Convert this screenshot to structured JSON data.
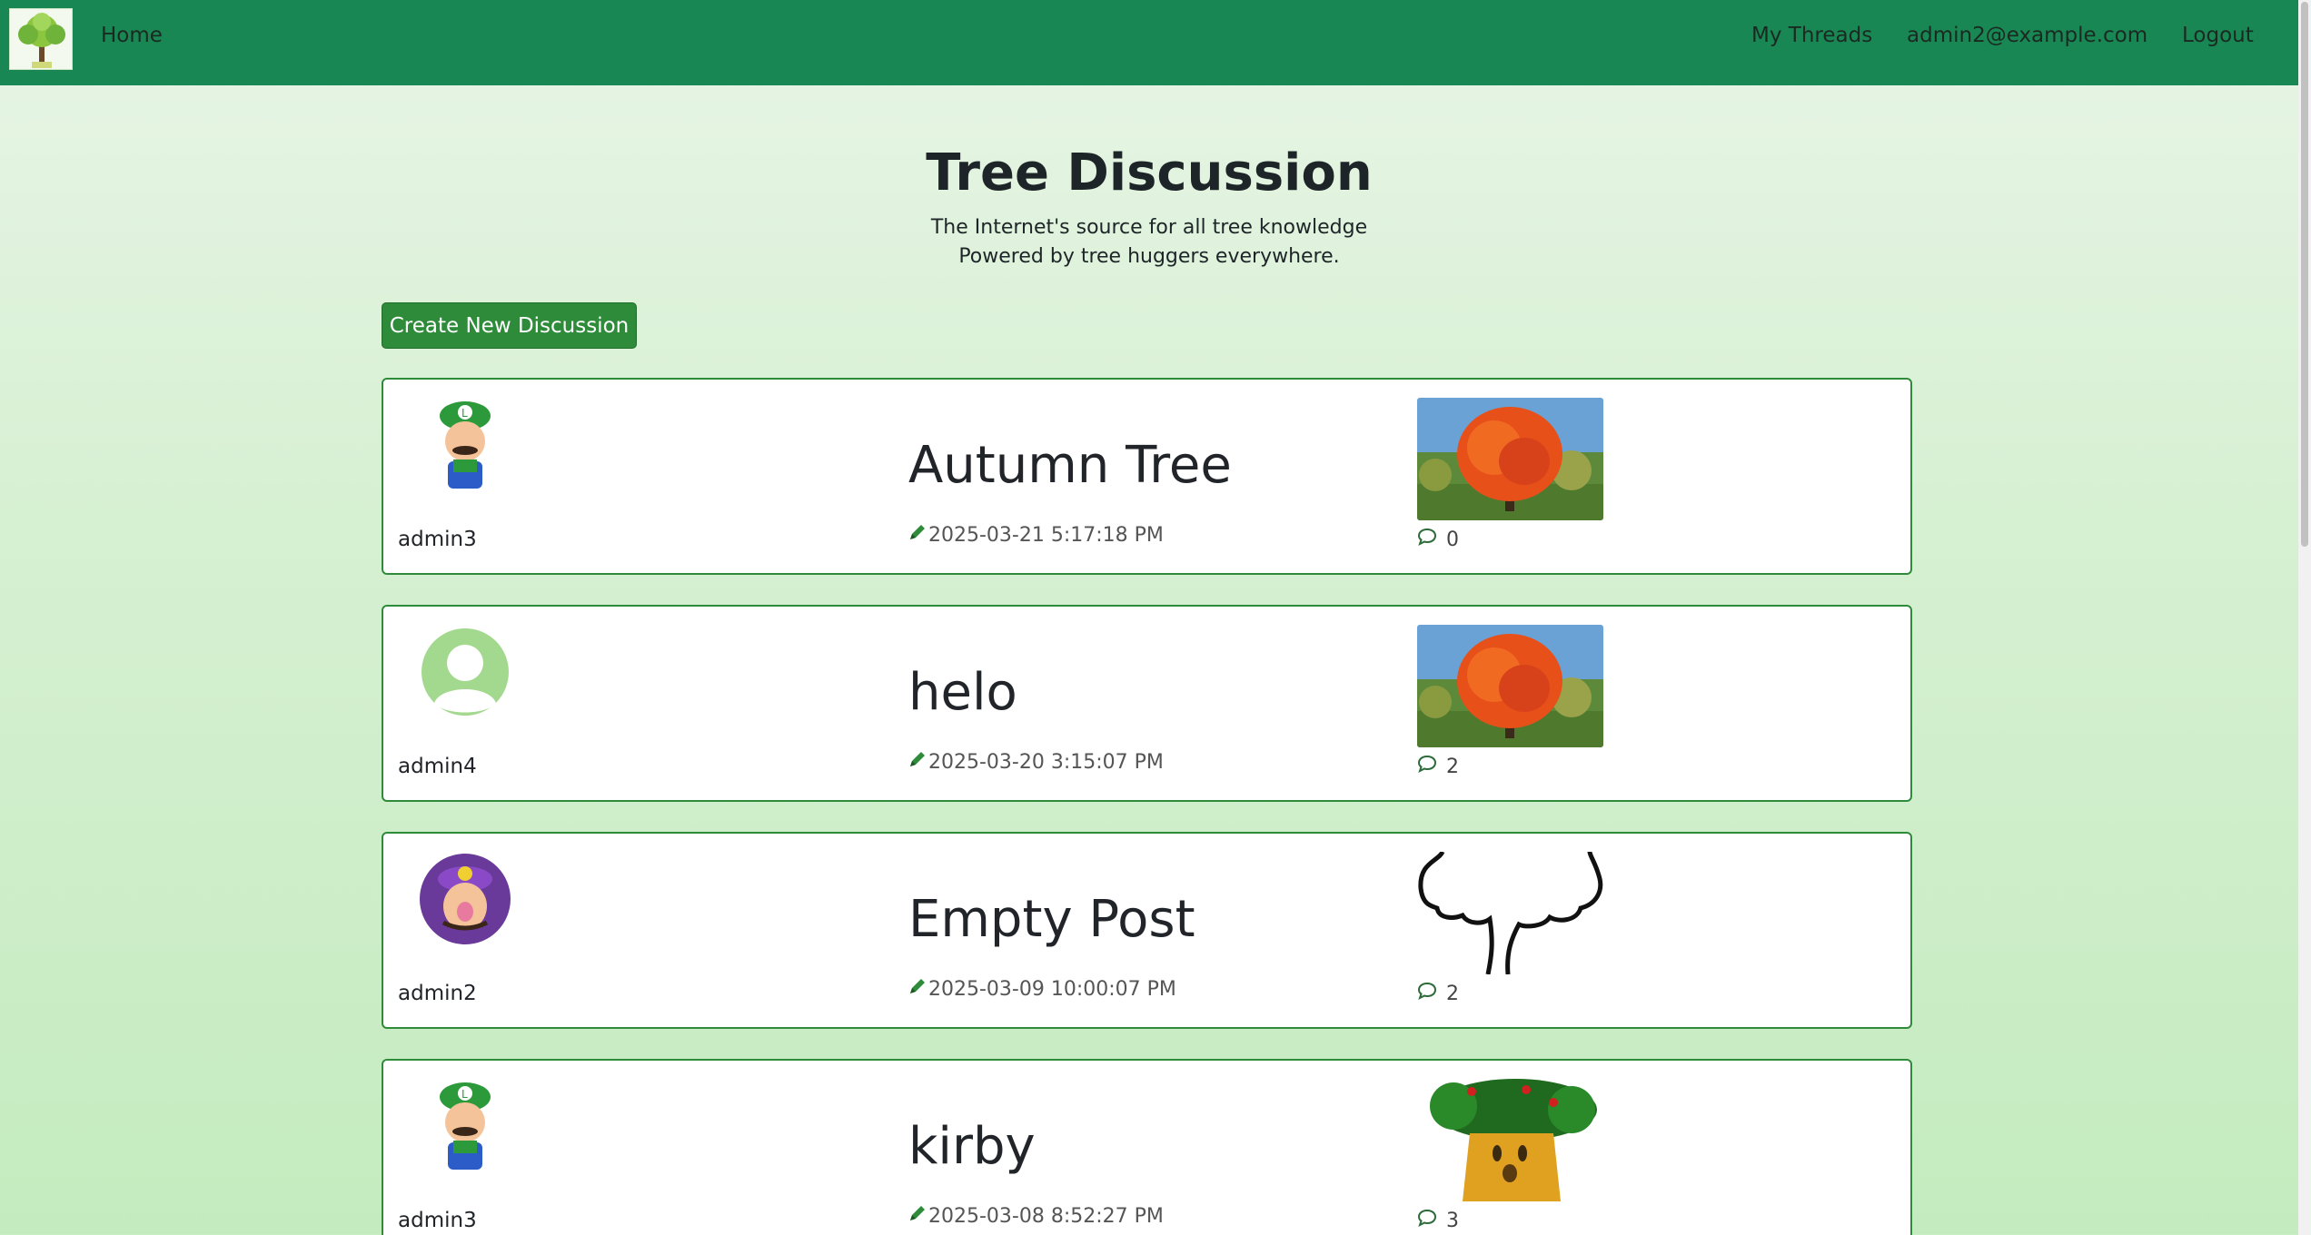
{
  "nav": {
    "home": "Home",
    "my_threads": "My Threads",
    "user_email": "admin2@example.com",
    "logout": "Logout"
  },
  "header": {
    "title": "Tree Discussion",
    "subtitle_line1": "The Internet's source for all tree knowledge",
    "subtitle_line2": "Powered by tree huggers everywhere."
  },
  "create_button": "Create New Discussion",
  "threads": [
    {
      "author": "admin3",
      "title": "Autumn Tree",
      "date": "2025-03-21 5:17:18 PM",
      "comments": "0"
    },
    {
      "author": "admin4",
      "title": "helo",
      "date": "2025-03-20 3:15:07 PM",
      "comments": "2"
    },
    {
      "author": "admin2",
      "title": "Empty Post",
      "date": "2025-03-09 10:00:07 PM",
      "comments": "2"
    },
    {
      "author": "admin3",
      "title": "kirby",
      "date": "2025-03-08 8:52:27 PM",
      "comments": "3"
    }
  ],
  "colors": {
    "navbar": "#198754",
    "accent": "#2e8b3a"
  }
}
